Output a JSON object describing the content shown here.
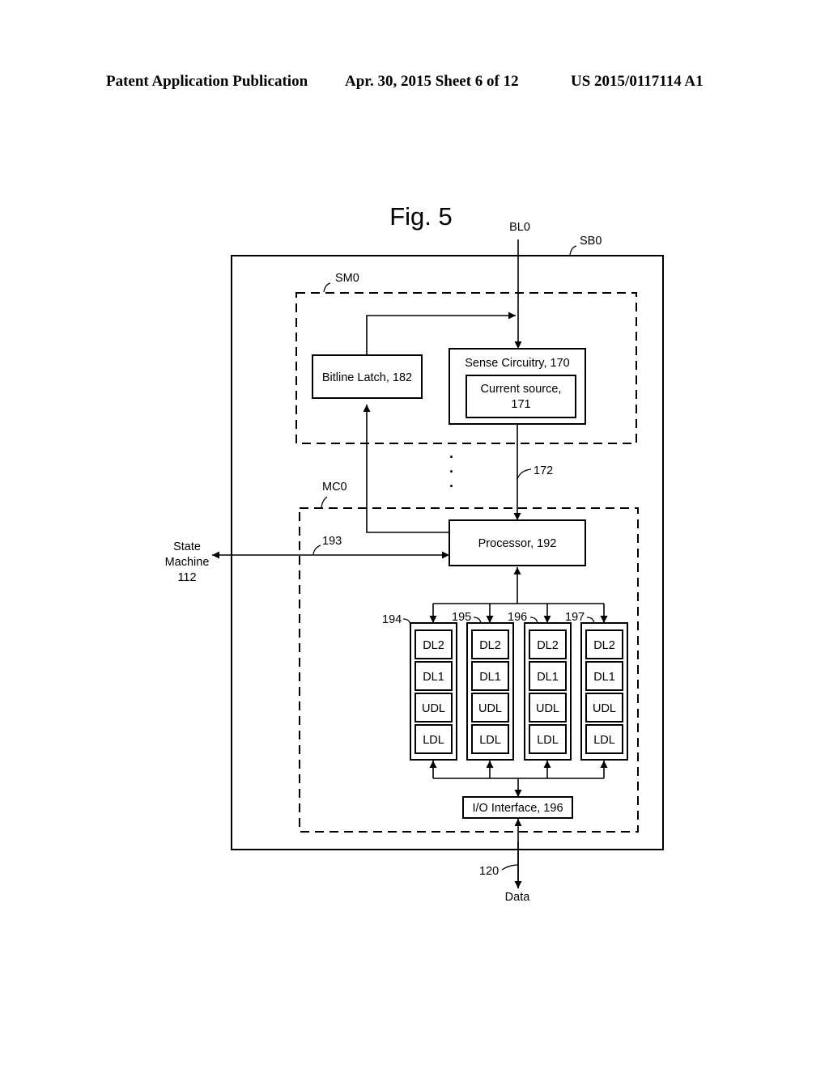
{
  "header": {
    "left": "Patent Application Publication",
    "center": "Apr. 30, 2015  Sheet 6 of 12",
    "right": "US 2015/0117114 A1"
  },
  "figure": {
    "title": "Fig. 5",
    "signals": {
      "bitline": "BL0",
      "data": "Data",
      "state_machine": [
        "State",
        "Machine",
        "112"
      ]
    },
    "containers": {
      "sense_block": "SB0",
      "sense_module": "SM0",
      "managing_circuit": "MC0"
    },
    "blocks": {
      "bitline_latch": "Bitline Latch, 182",
      "sense_circuitry": "Sense Circuitry, 170",
      "current_source": [
        "Current source,",
        "171"
      ],
      "processor": "Processor, 192",
      "io_interface": "I/O Interface, 196"
    },
    "refs": {
      "bus_172": "172",
      "bus_193": "193",
      "bus_120": "120"
    },
    "latch_stacks": [
      {
        "ref": "194",
        "latches": [
          "DL2",
          "DL1",
          "UDL",
          "LDL"
        ]
      },
      {
        "ref": "195",
        "latches": [
          "DL2",
          "DL1",
          "UDL",
          "LDL"
        ]
      },
      {
        "ref": "196",
        "latches": [
          "DL2",
          "DL1",
          "UDL",
          "LDL"
        ]
      },
      {
        "ref": "197",
        "latches": [
          "DL2",
          "DL1",
          "UDL",
          "LDL"
        ]
      }
    ],
    "ellipsis": [
      "·",
      "·",
      "·"
    ]
  }
}
